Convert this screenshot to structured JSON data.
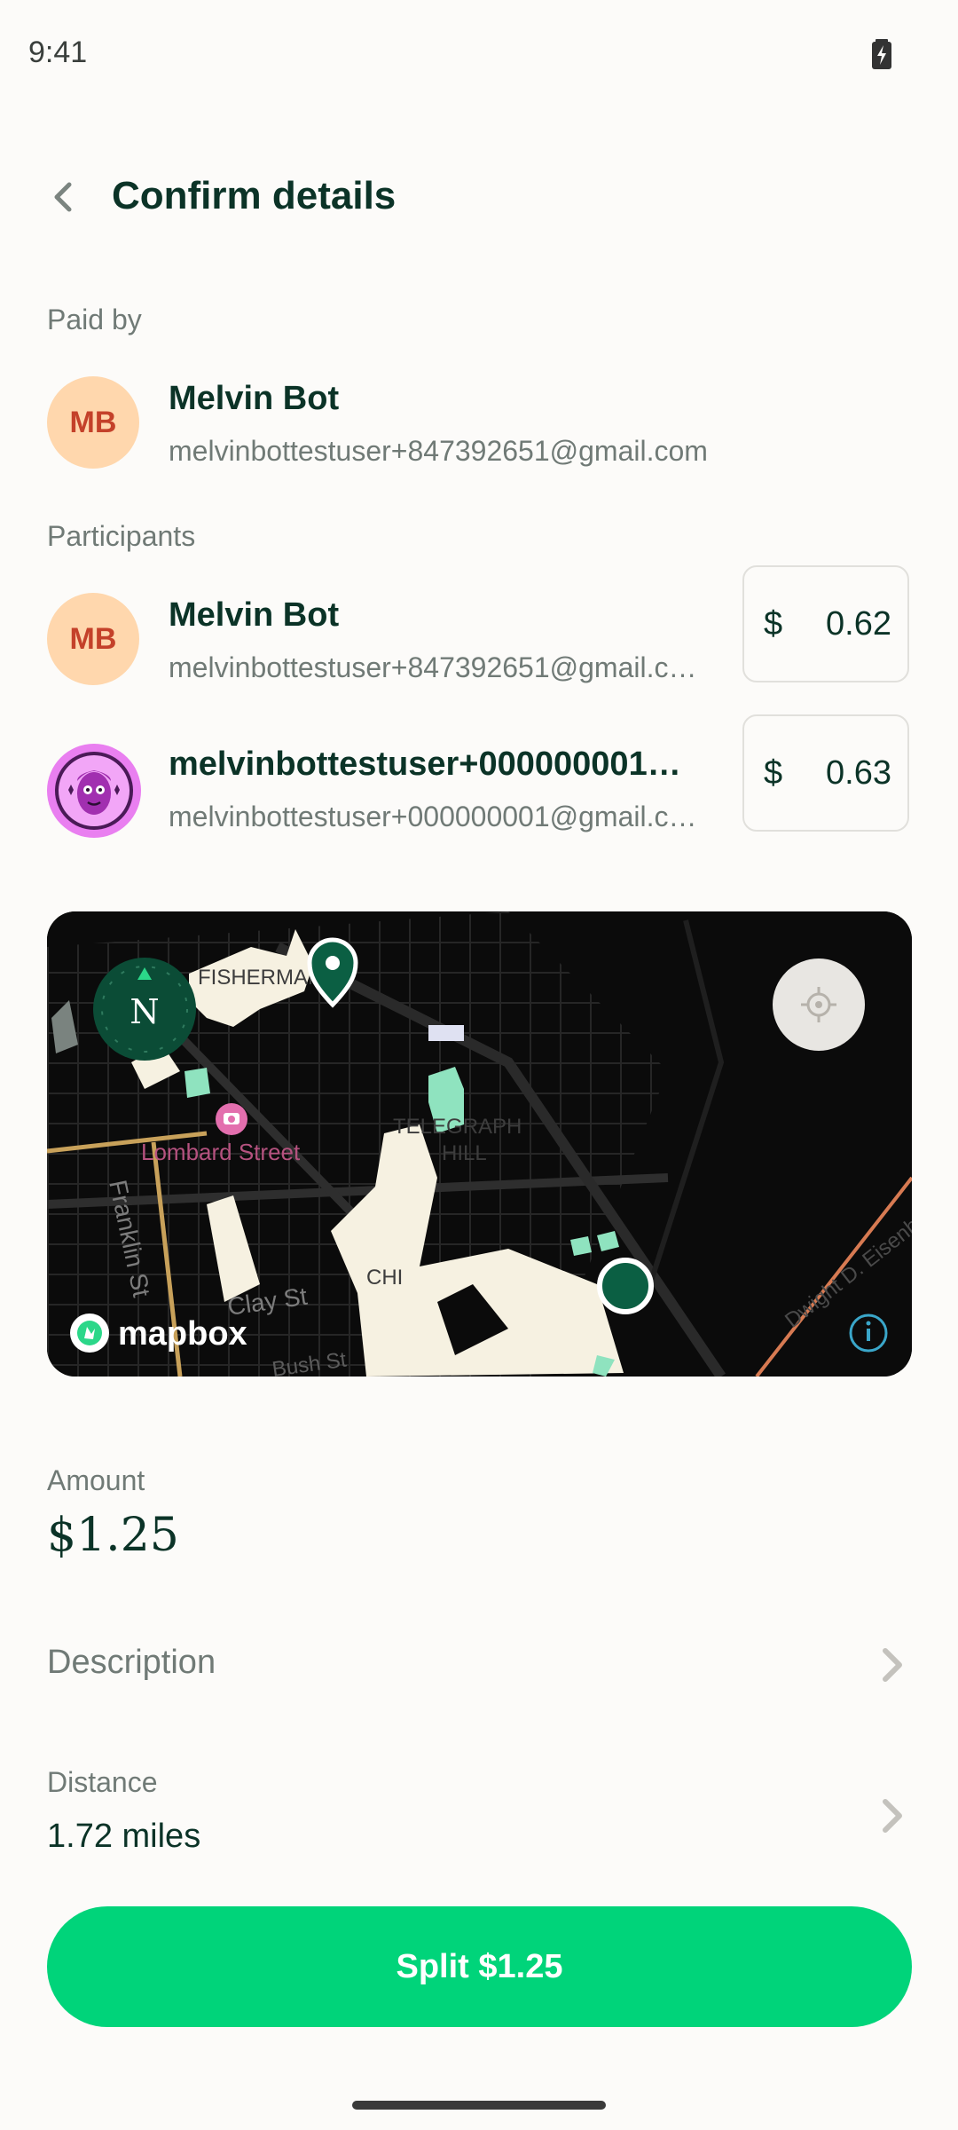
{
  "status_bar": {
    "time": "9:41"
  },
  "header": {
    "title": "Confirm details"
  },
  "paid_by": {
    "label": "Paid by",
    "initials": "MB",
    "name": "Melvin Bot",
    "email": "melvinbottestuser+847392651@gmail.com"
  },
  "participants": {
    "label": "Participants",
    "items": [
      {
        "initials": "MB",
        "name": "Melvin Bot",
        "email": "melvinbottestuser+847392651@gmail.com",
        "currency": "$",
        "amount": "0.62"
      },
      {
        "name": "melvinbottestuser+000000001@gmail.com",
        "email": "melvinbottestuser+000000001@gmail.com",
        "currency": "$",
        "amount": "0.63"
      }
    ]
  },
  "map": {
    "compass": "N",
    "street_labels": [
      "FISHERMAN",
      "Lombard Street",
      "TELEGRAPH",
      "HILL",
      "Franklin St",
      "Clay St",
      "CHI",
      "Bush St",
      "Dwight D. Eisenh"
    ],
    "attribution": "mapbox"
  },
  "amount": {
    "label": "Amount",
    "value": "$1.25"
  },
  "description": {
    "label": "Description"
  },
  "distance": {
    "label": "Distance",
    "value": "1.72 miles"
  },
  "split_button": {
    "label": "Split $1.25"
  },
  "colors": {
    "accent": "#00d47a",
    "text": "#0b3327",
    "muted": "#707a76",
    "avatar_bg": "#ffd7ad"
  }
}
